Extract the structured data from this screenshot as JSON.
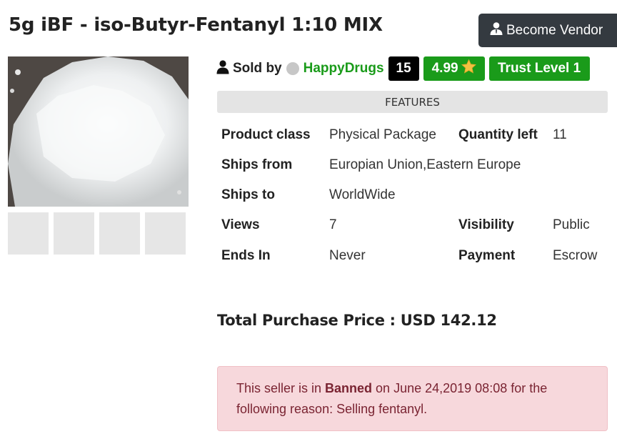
{
  "product": {
    "title": "5g iBF - iso-Butyr-Fentanyl 1:10 MIX"
  },
  "header": {
    "become_vendor_label": "Become Vendor"
  },
  "seller": {
    "sold_by_label": "Sold by",
    "name": "HappyDrugs",
    "sales_count": "15",
    "rating": "4.99",
    "trust_level": "Trust Level 1",
    "colors": {
      "green": "#1a9b1a",
      "black": "#000000"
    }
  },
  "features": {
    "heading": "FEATURES",
    "product_class_label": "Product class",
    "product_class_value": "Physical Package",
    "quantity_left_label": "Quantity left",
    "quantity_left_value": "11",
    "ships_from_label": "Ships from",
    "ships_from_value": "Europian Union,Eastern Europe",
    "ships_to_label": "Ships to",
    "ships_to_value": "WorldWide",
    "views_label": "Views",
    "views_value": "7",
    "visibility_label": "Visibility",
    "visibility_value": "Public",
    "ends_in_label": "Ends In",
    "ends_in_value": "Never",
    "payment_label": "Payment",
    "payment_value": "Escrow"
  },
  "total": {
    "text": "Total Purchase Price : USD 142.12"
  },
  "alert": {
    "prefix": "This seller is in ",
    "status": "Banned",
    "suffix": " on June 24,2019 08:08 for the following reason: Selling fentanyl.",
    "color": "#7a2432"
  },
  "icons": {
    "vendor": "vendor-user-icon",
    "user": "user-icon",
    "star": "star-icon"
  }
}
